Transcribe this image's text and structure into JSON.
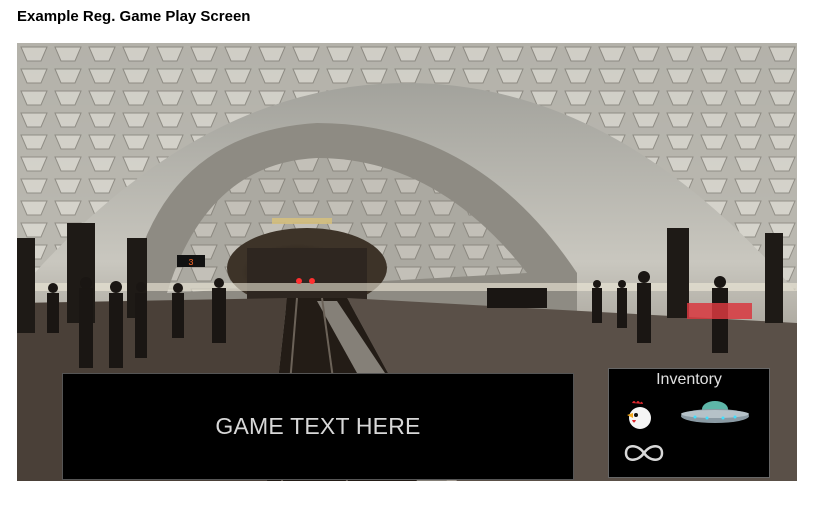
{
  "page": {
    "heading": "Example Reg. Game Play Screen"
  },
  "scene": {
    "background_icon": "subway-station-background",
    "sign_text": "3"
  },
  "game_text": {
    "placeholder": "GAME TEXT HERE"
  },
  "inventory": {
    "title": "Inventory",
    "items": [
      {
        "name": "chicken",
        "icon": "chicken-icon"
      },
      {
        "name": "ufo",
        "icon": "ufo-icon"
      },
      {
        "name": "infinity",
        "icon": "infinity-icon"
      }
    ]
  }
}
